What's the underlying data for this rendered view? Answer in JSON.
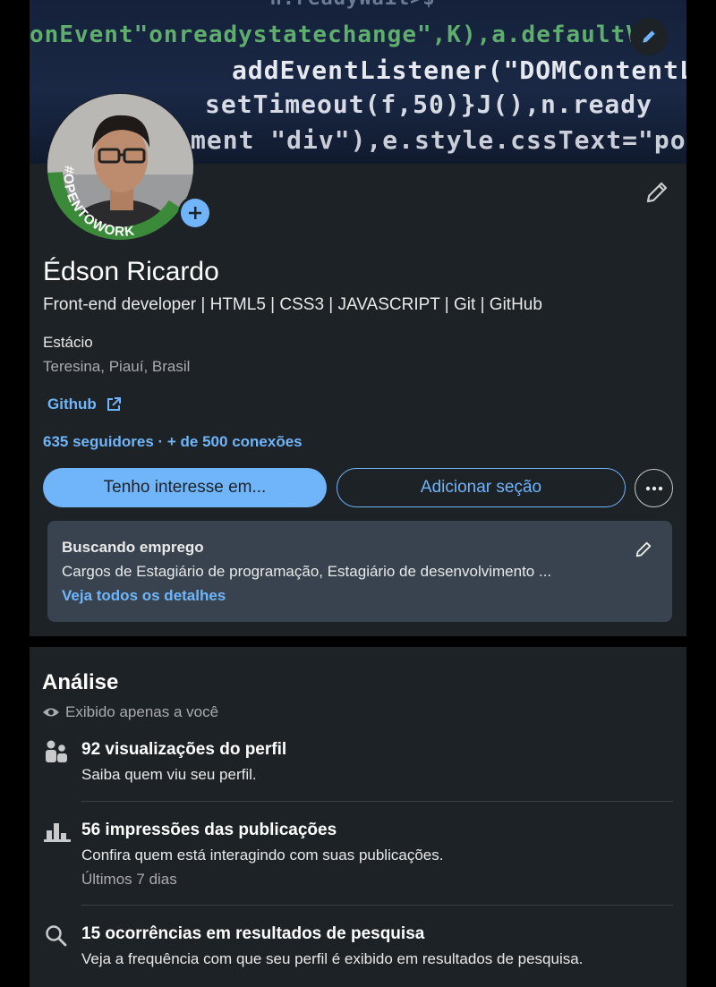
{
  "banner": {
    "code_lines": [
      "··n.readyWait>$···",
      "onEvent\"onreadystatechange\",K),a.defaultV",
      "addEventListener(\"DOMContentLo",
      "setTimeout(f,50)}J(),n.ready",
      "ment \"div\"),e.style.cssText=\"posi"
    ]
  },
  "avatar": {
    "badge_text": "#OPENTOWORK"
  },
  "profile": {
    "name": "Édson Ricardo",
    "headline": "Front-end developer | HTML5 | CSS3 | JAVASCRIPT | Git | GitHub",
    "education": "Estácio",
    "location": "Teresina, Piauí, Brasil",
    "link_label": "Github",
    "followers": "635 seguidores",
    "separator": " · ",
    "connections": "+ de 500 conexões"
  },
  "actions": {
    "primary_label": "Tenho interesse em...",
    "secondary_label": "Adicionar seção"
  },
  "open_to_work": {
    "title": "Buscando emprego",
    "roles": "Cargos de Estagiário de programação, Estagiário de desenvolvimento ...",
    "details_link": "Veja todos os detalhes"
  },
  "analytics": {
    "title": "Análise",
    "visibility": "Exibido apenas a você",
    "items": [
      {
        "icon": "people-icon",
        "title": "92 visualizações do perfil",
        "desc": "Saiba quem viu seu perfil.",
        "note": ""
      },
      {
        "icon": "bar-chart-icon",
        "title": "56 impressões das publicações",
        "desc": "Confira quem está interagindo com suas publicações.",
        "note": "Últimos 7 dias"
      },
      {
        "icon": "search-icon",
        "title": "15 ocorrências em resultados de pesquisa",
        "desc": "Veja a frequência com que seu perfil é exibido em resultados de pesquisa.",
        "note": ""
      }
    ]
  },
  "colors": {
    "background": "#000000",
    "card": "#1d2226",
    "accent": "#70b5f9",
    "open_to_work_green": "#3a8a3a",
    "otw_box": "#38434f"
  }
}
